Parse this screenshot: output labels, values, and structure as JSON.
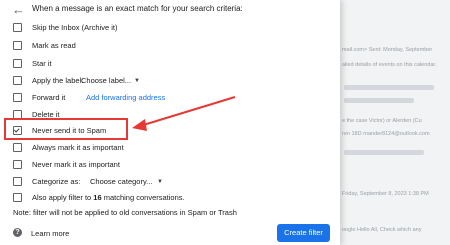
{
  "background_emails": [
    "mail.com> Sent: Monday, September",
    "ailed details of events on this calendar.",
    "e the case Victor) or Alerden (Cu",
    "ren 18D rnander8124@outlook.com",
    "Friday, September 8, 2023 1:38 PM",
    "oogle Hello All, Check which any"
  ],
  "header": {
    "back_icon": "back-arrow-icon",
    "title": "When a message is an exact match for your search criteria:"
  },
  "options": [
    {
      "label": "Skip the Inbox (Archive it)",
      "checked": false
    },
    {
      "label": "Mark as read",
      "checked": false
    },
    {
      "label": "Star it",
      "checked": false
    },
    {
      "label": "Apply the label:",
      "checked": false
    },
    {
      "label": "Forward it",
      "checked": false
    },
    {
      "label": "Delete it",
      "checked": false
    },
    {
      "label": "Never send it to Spam",
      "checked": true
    },
    {
      "label": "Always mark it as important",
      "checked": false
    },
    {
      "label": "Never mark it as important",
      "checked": false
    },
    {
      "label": "Categorize as:",
      "checked": false
    },
    {
      "label_prefix": "Also apply filter to ",
      "count": "16",
      "label_suffix": " matching conversations.",
      "checked": false
    }
  ],
  "label_select": {
    "value": "Choose label...",
    "icon": "caret-down-icon"
  },
  "forward_link": "Add forwarding address",
  "category_select": {
    "value": "Choose category...",
    "icon": "caret-down-icon"
  },
  "note": "Note: filter will not be applied to old conversations in Spam or Trash",
  "learn_more": "Learn more",
  "create_button": "Create filter",
  "colors": {
    "accent": "#1a73e8",
    "highlight": "#e53935"
  }
}
